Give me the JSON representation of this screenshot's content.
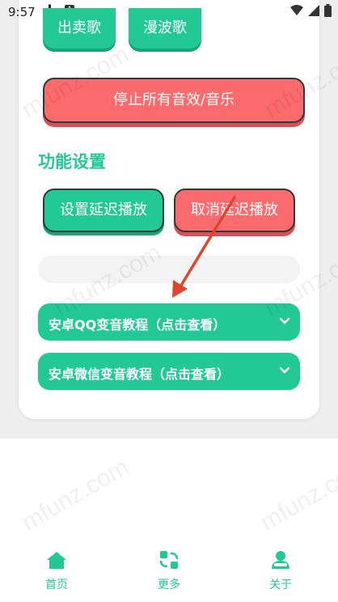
{
  "status_bar": {
    "time": "9:57",
    "a_badge": "A"
  },
  "buttons": {
    "sell_song": "出卖歌",
    "wave_song": "漫波歌",
    "stop_all": "停止所有音效/音乐"
  },
  "section": {
    "title": "功能设置"
  },
  "settings": {
    "set_delay": "设置延迟播放",
    "cancel_delay": "取消延迟播放"
  },
  "accordions": [
    {
      "label": "安卓QQ变音教程（点击查看）"
    },
    {
      "label": "安卓微信变音教程（点击查看）"
    }
  ],
  "nav": [
    {
      "label": "首页",
      "icon": "home-icon"
    },
    {
      "label": "更多",
      "icon": "swap-icon"
    },
    {
      "label": "关于",
      "icon": "about-icon"
    }
  ],
  "watermark": "mfunz.com",
  "colors": {
    "accent": "#22c993",
    "danger": "#fb6b6e",
    "arrow": "#e0442f"
  }
}
